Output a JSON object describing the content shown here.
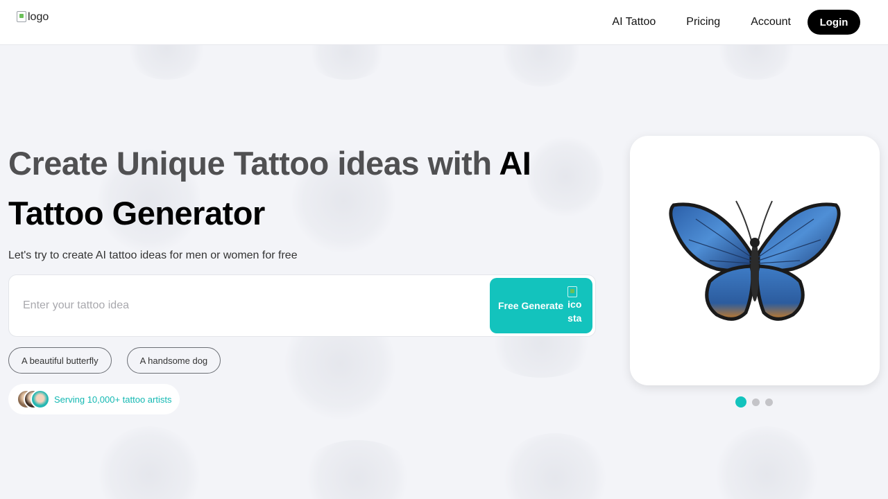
{
  "header": {
    "logo_alt": "logo",
    "nav": [
      {
        "label": "AI Tattoo"
      },
      {
        "label": "Pricing"
      },
      {
        "label": "Account"
      }
    ],
    "login_label": "Login"
  },
  "hero": {
    "headline_part1": "Create Unique Tattoo ideas with ",
    "headline_part2": "AI Tattoo Generator",
    "subtitle": "Let's try to create AI tattoo ideas for men or women for free",
    "search_placeholder": "Enter your tattoo idea",
    "search_value": "",
    "generate_label": "Free Generate",
    "generate_icon_alt_line1": "ico",
    "generate_icon_alt_line2": "sta",
    "chips": [
      {
        "label": "A beautiful butterfly"
      },
      {
        "label": "A handsome dog"
      }
    ],
    "serving_text": "Serving 10,000+ tattoo artists"
  },
  "showcase": {
    "image": "blue-butterfly-tattoo",
    "slides_total": 3,
    "active_slide": 1
  },
  "colors": {
    "accent": "#13c3bd",
    "background": "#f3f4f8",
    "login_bg": "#000000"
  }
}
